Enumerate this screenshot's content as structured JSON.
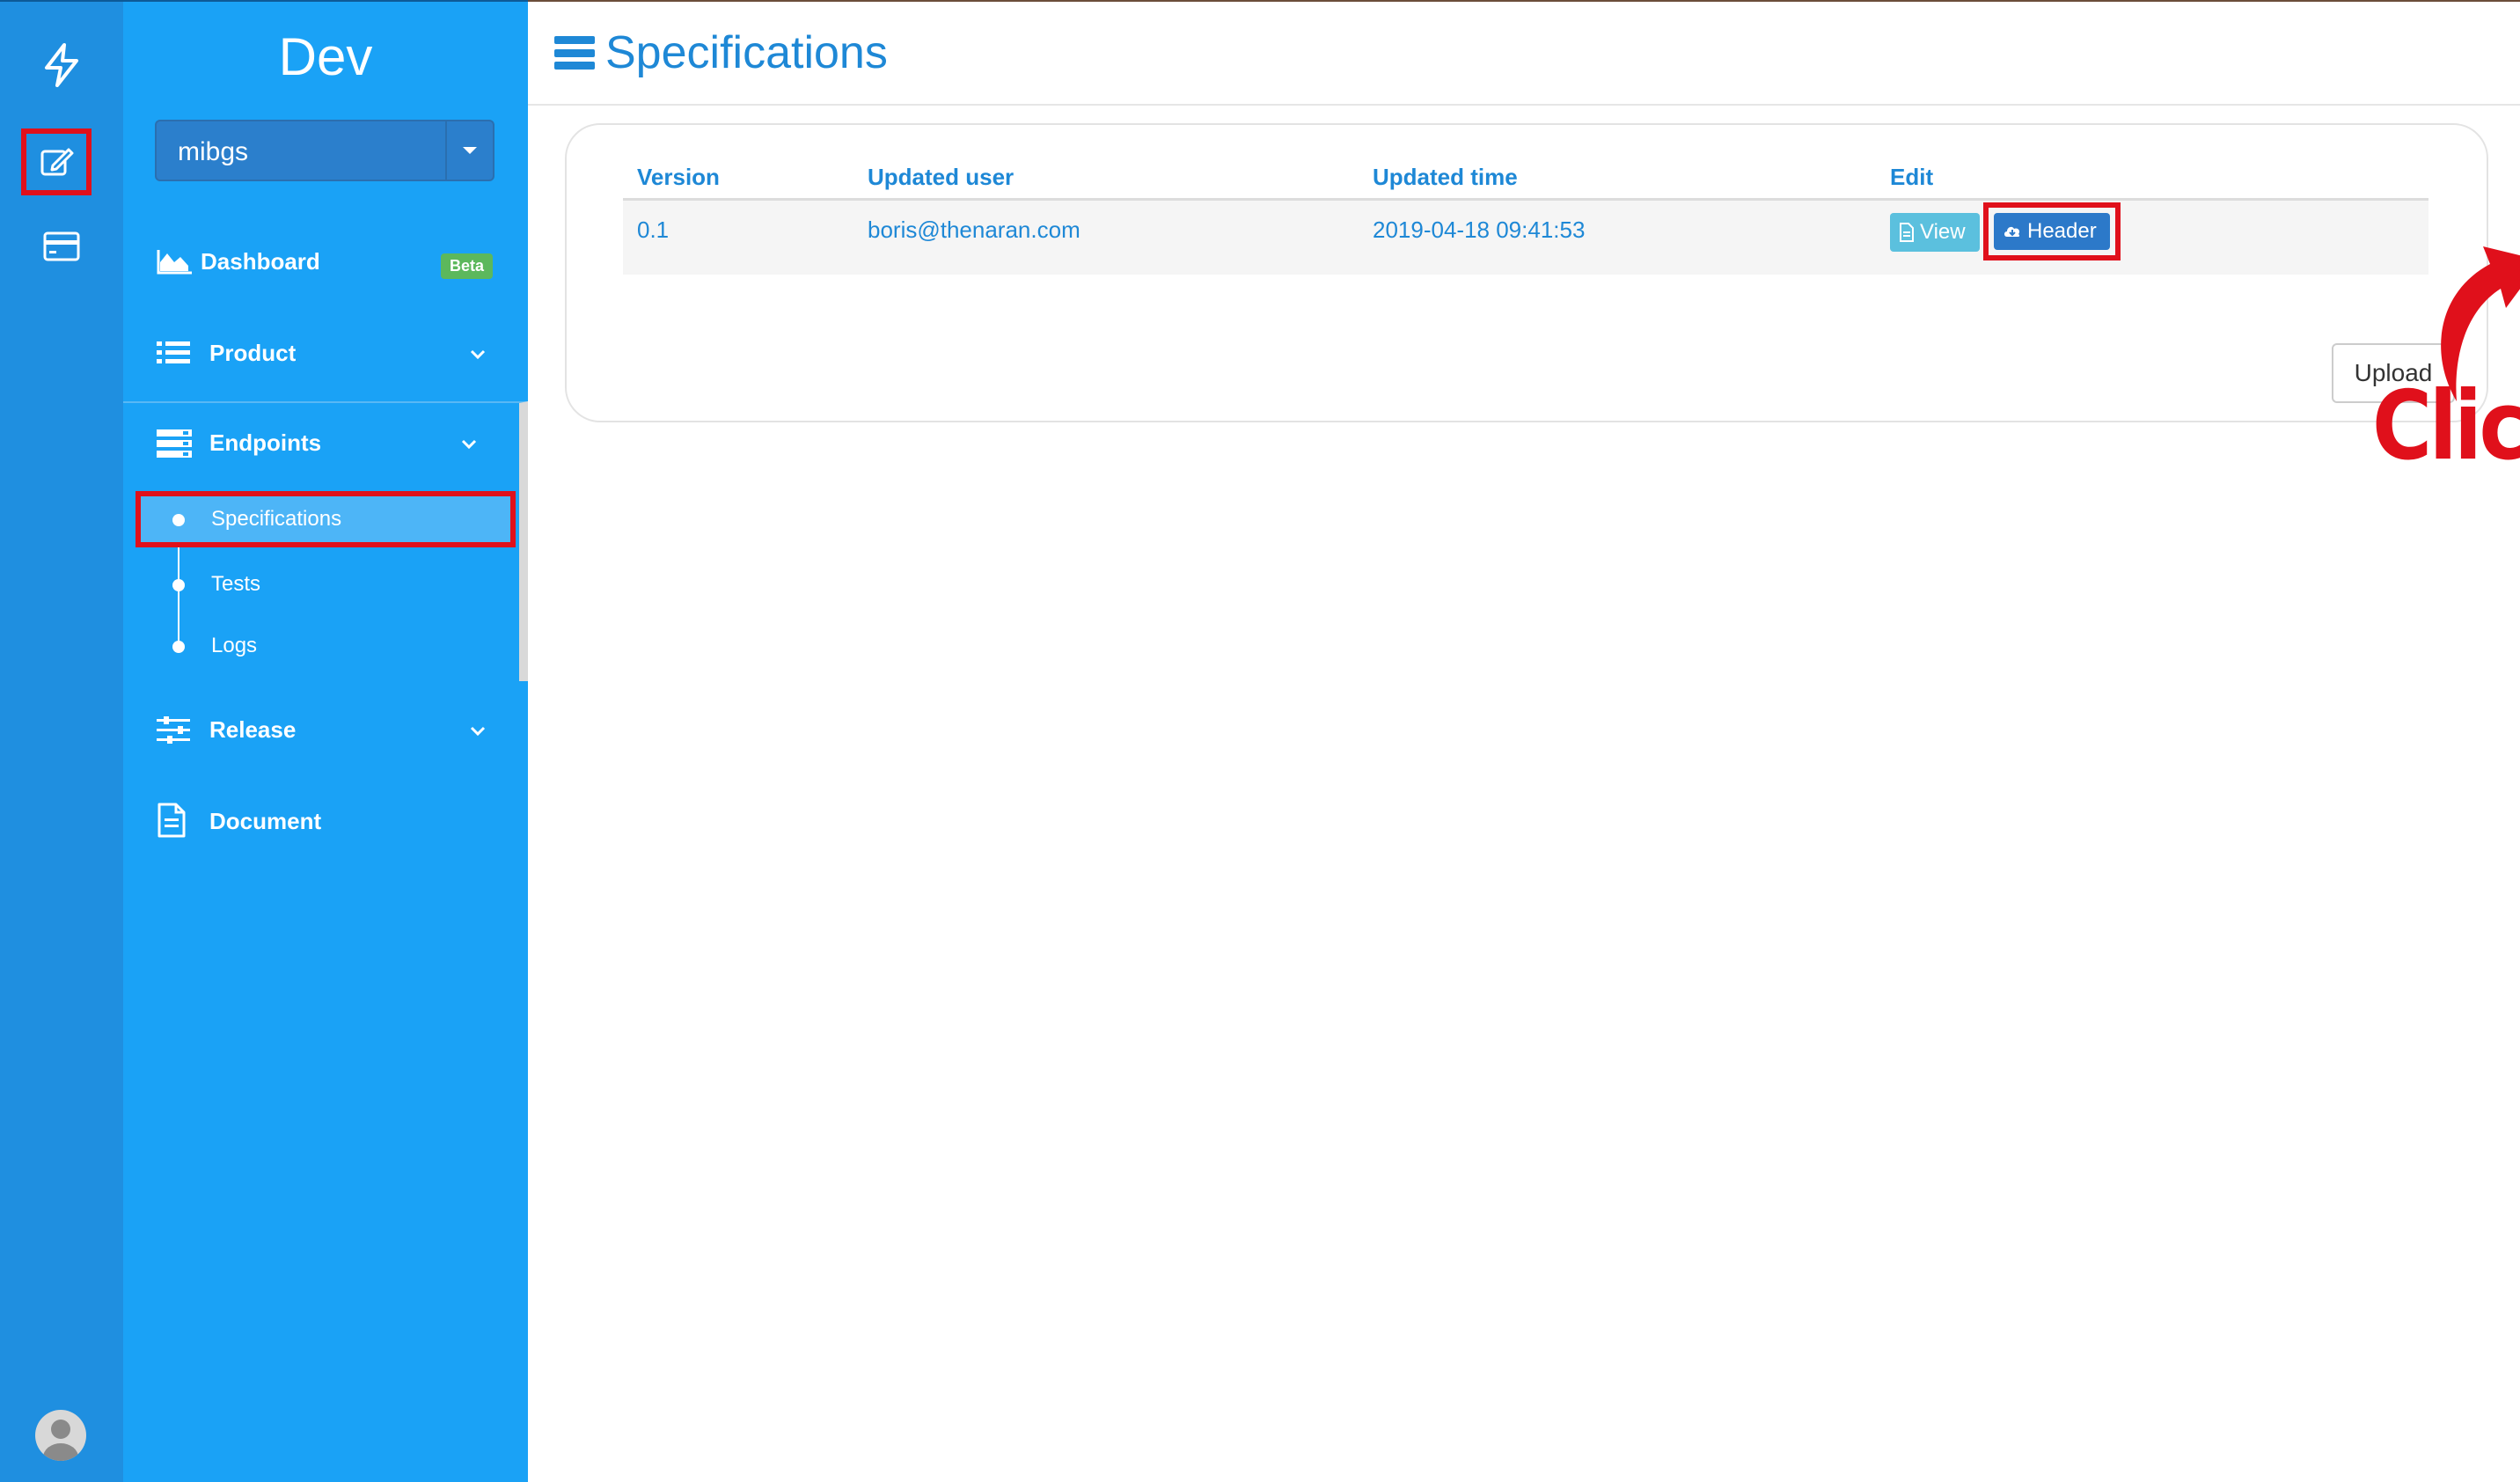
{
  "sidebar": {
    "title": "Dev",
    "project": "mibgs",
    "menu": {
      "dashboard": "Dashboard",
      "beta_badge": "Beta",
      "product": "Product",
      "endpoints": "Endpoints",
      "release": "Release",
      "document": "Document"
    },
    "endpoints_sub": {
      "specifications": "Specifications",
      "tests": "Tests",
      "logs": "Logs"
    }
  },
  "page": {
    "title": "Specifications"
  },
  "table": {
    "headers": {
      "version": "Version",
      "updated_user": "Updated user",
      "updated_time": "Updated time",
      "edit": "Edit"
    },
    "rows": [
      {
        "version": "0.1",
        "updated_user": "boris@thenaran.com",
        "updated_time": "2019-04-18 09:41:53",
        "view_label": "View",
        "header_label": "Header"
      }
    ]
  },
  "upload_label": "Upload",
  "annotation": {
    "text": "Click",
    "color": "#e0101b"
  },
  "colors": {
    "rail": "#1f8fe0",
    "sidebar": "#1aa2f6",
    "accent": "#1e88d6",
    "highlight": "#e0101b"
  }
}
